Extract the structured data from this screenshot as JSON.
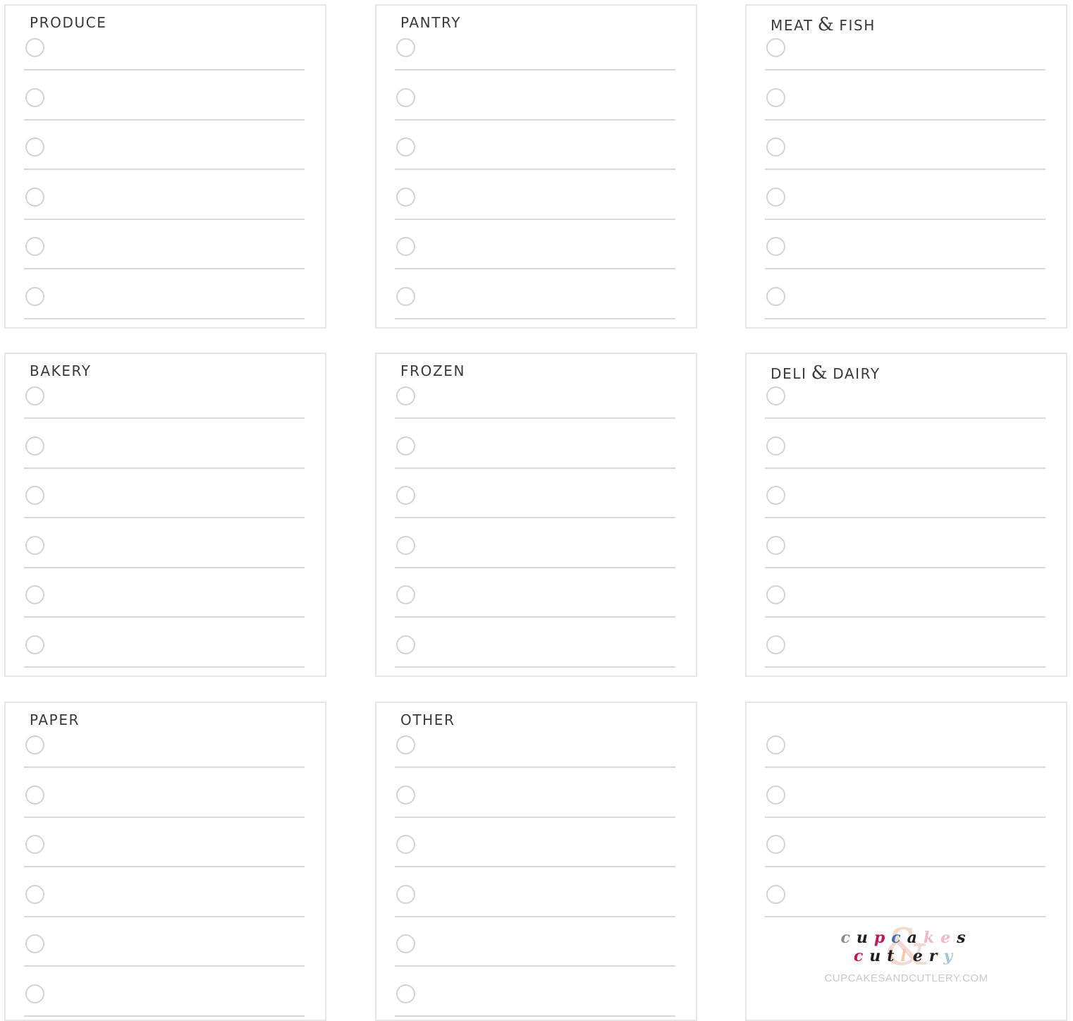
{
  "panels": [
    {
      "title_parts": [
        "PRODUCE"
      ],
      "rows": 6
    },
    {
      "title_parts": [
        "PANTRY"
      ],
      "rows": 6
    },
    {
      "title_parts": [
        "MEAT",
        "&",
        "FISH"
      ],
      "rows": 6
    },
    {
      "title_parts": [
        "BAKERY"
      ],
      "rows": 6
    },
    {
      "title_parts": [
        "FROZEN"
      ],
      "rows": 6
    },
    {
      "title_parts": [
        "DELI",
        "&",
        "DAIRY"
      ],
      "rows": 6
    },
    {
      "title_parts": [
        "PAPER"
      ],
      "rows": 6
    },
    {
      "title_parts": [
        "OTHER"
      ],
      "rows": 6
    },
    {
      "title_parts": [],
      "rows": 4
    }
  ],
  "logo": {
    "amp": "&",
    "line1": [
      "c",
      "u",
      "p",
      "c",
      "a",
      "k",
      "e",
      "s"
    ],
    "line1_colors": [
      "#8a8a8a",
      "#1f1f1f",
      "#c2185b",
      "#3a6fb0",
      "#1f1f1f",
      "#f2b8c6",
      "#f2b8c6",
      "#1f1f1f"
    ],
    "line2": [
      "c",
      "u",
      "t",
      "l",
      "e",
      "r",
      "y"
    ],
    "line2_colors": [
      "#c2185b",
      "#1f1f1f",
      "#1f1f1f",
      "#f4c6a8",
      "#1f1f1f",
      "#1f1f1f",
      "#a5c8d8"
    ],
    "url": "CUPCAKESANDCUTLERY.COM"
  }
}
